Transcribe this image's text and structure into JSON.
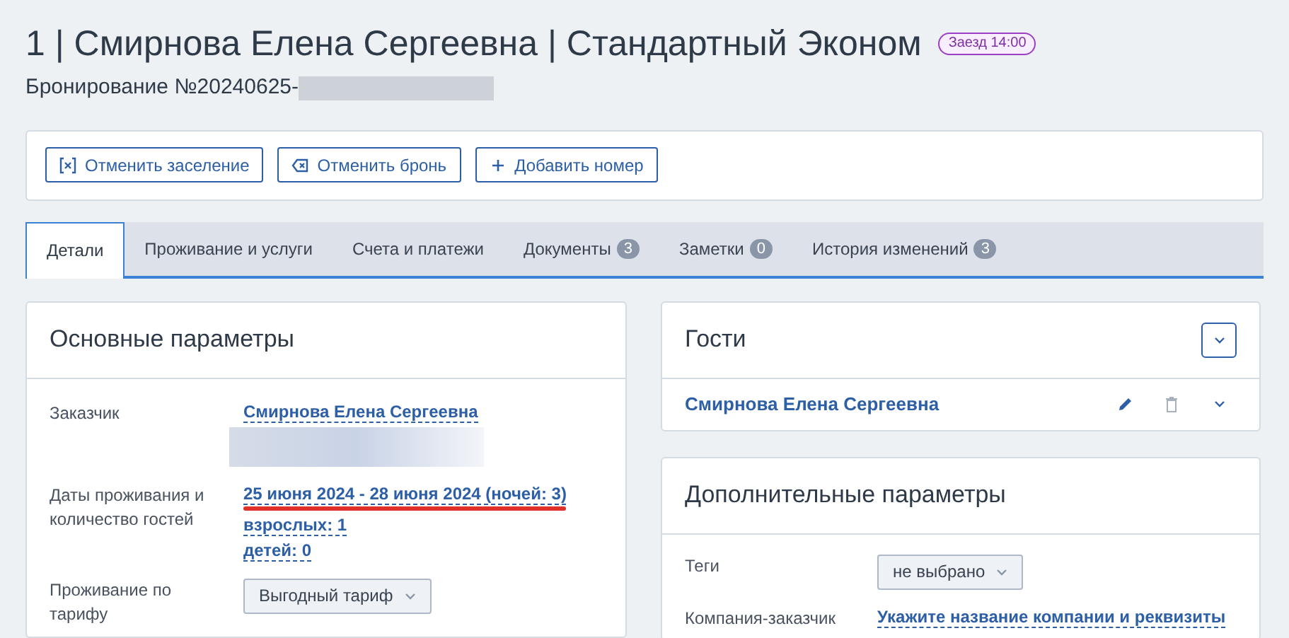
{
  "header": {
    "title": "1 | Смирнова Елена Сергеевна | Стандартный Эконом",
    "badge": "Заезд 14:00",
    "booking": "Бронирование №20240625-",
    "booking_redacted": true
  },
  "actions": [
    {
      "kind": "cancel-checkin",
      "label": "Отменить заселение"
    },
    {
      "kind": "cancel-booking",
      "label": "Отменить бронь"
    },
    {
      "kind": "add",
      "label": "Добавить номер"
    }
  ],
  "tabs": [
    {
      "label": "Детали",
      "selected": true
    },
    {
      "label": "Проживание и услуги",
      "selected": false
    },
    {
      "label": "Счета и платежи",
      "selected": false
    },
    {
      "label": "Документы",
      "count": "3",
      "selected": false
    },
    {
      "label": "Заметки",
      "count": "0",
      "selected": false
    },
    {
      "label": "История изменений",
      "count": "3",
      "selected": false
    }
  ],
  "main_params": {
    "title": "Основные параметры",
    "rows": [
      {
        "label": "Заказчик",
        "kind": "links",
        "redacted": true,
        "values": [
          {
            "text": "Смирнова Елена Сергеевна",
            "marked": false
          }
        ]
      },
      {
        "label": "Даты проживания и количество гостей",
        "kind": "links",
        "redacted": false,
        "values": [
          {
            "text": "25 июня 2024 - 28 июня 2024 (ночей: 3)",
            "marked": true
          },
          {
            "text": "взрослых: 1",
            "marked": false
          },
          {
            "text": "детей: 0",
            "marked": false
          }
        ]
      },
      {
        "label": "Проживание по тарифу",
        "kind": "dropdown",
        "value": "Выгодный тариф"
      }
    ]
  },
  "guests": {
    "title": "Гости",
    "items": [
      {
        "name": "Смирнова Елена Сергеевна"
      }
    ]
  },
  "extra_params": {
    "title": "Дополнительные параметры",
    "rows": [
      {
        "label": "Теги",
        "kind": "dropdown",
        "value": "не выбрано"
      },
      {
        "label": "Компания-заказчик",
        "kind": "link",
        "value": "Укажите название компании и реквизиты"
      }
    ]
  }
}
